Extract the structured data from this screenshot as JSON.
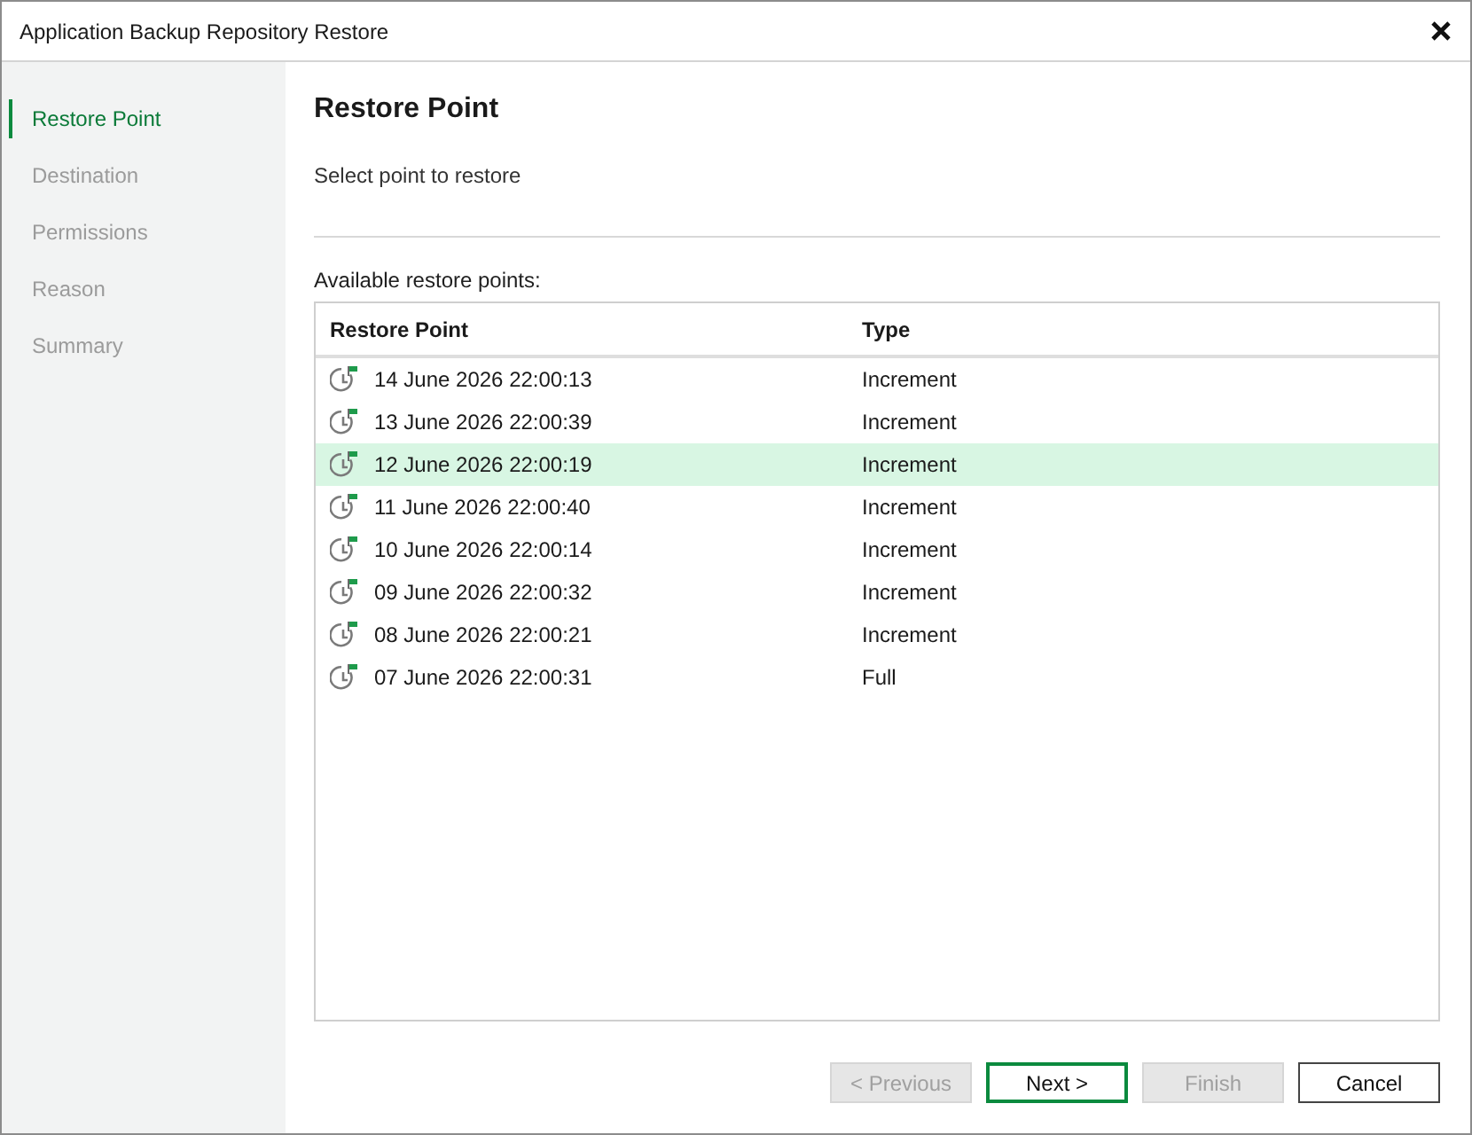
{
  "window": {
    "title": "Application Backup Repository Restore"
  },
  "steps": [
    {
      "label": "Restore Point",
      "selected": true
    },
    {
      "label": "Destination",
      "selected": false
    },
    {
      "label": "Permissions",
      "selected": false
    },
    {
      "label": "Reason",
      "selected": false
    },
    {
      "label": "Summary",
      "selected": false
    }
  ],
  "page": {
    "heading": "Restore Point",
    "description": "Select point to restore"
  },
  "restore_points": {
    "label": "Available restore points:",
    "columns": [
      "Restore Point",
      "Type"
    ],
    "rows": [
      {
        "restore_point": "14 June 2026 22:00:13",
        "type": "Increment",
        "selected": false
      },
      {
        "restore_point": "13 June 2026 22:00:39",
        "type": "Increment",
        "selected": false
      },
      {
        "restore_point": "12 June 2026 22:00:19",
        "type": "Increment",
        "selected": true
      },
      {
        "restore_point": "11 June 2026 22:00:40",
        "type": "Increment",
        "selected": false
      },
      {
        "restore_point": "10 June 2026 22:00:14",
        "type": "Increment",
        "selected": false
      },
      {
        "restore_point": "09 June 2026 22:00:32",
        "type": "Increment",
        "selected": false
      },
      {
        "restore_point": "08 June 2026 22:00:21",
        "type": "Increment",
        "selected": false
      },
      {
        "restore_point": "07 June 2026 22:00:31",
        "type": "Full",
        "selected": false
      }
    ]
  },
  "buttons": [
    {
      "label": "< Previous",
      "disabled": true,
      "default": false
    },
    {
      "label": "Next >",
      "disabled": false,
      "default": true
    },
    {
      "label": "Finish",
      "disabled": true,
      "default": false
    },
    {
      "label": "Cancel",
      "disabled": false,
      "default": false
    }
  ]
}
